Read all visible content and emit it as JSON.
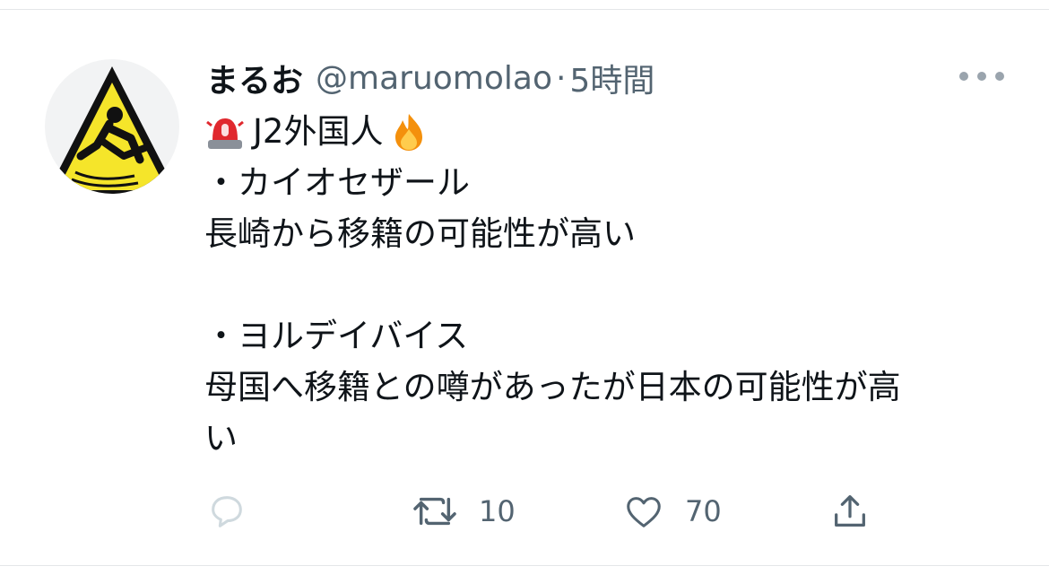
{
  "tweet": {
    "author_name": "まるお",
    "handle": "@maruomolao",
    "separator": "·",
    "time": "5時間",
    "lines": [
      "J2外国人",
      "・カイオセザール",
      "長崎から移籍の可能性が高い",
      "",
      "・ヨルデイバイス",
      "母国へ移籍との噂があったが日本の可能性が高",
      "い"
    ],
    "emojis": [
      "police-light-emoji",
      "fire-emoji"
    ]
  },
  "actions": {
    "reply_count": "",
    "retweet_count": "10",
    "like_count": "70"
  },
  "colors": {
    "text": "#0f1419",
    "muted": "#536471",
    "divider": "#e4e6e8",
    "avatar_yellow": "#f5e52a"
  }
}
